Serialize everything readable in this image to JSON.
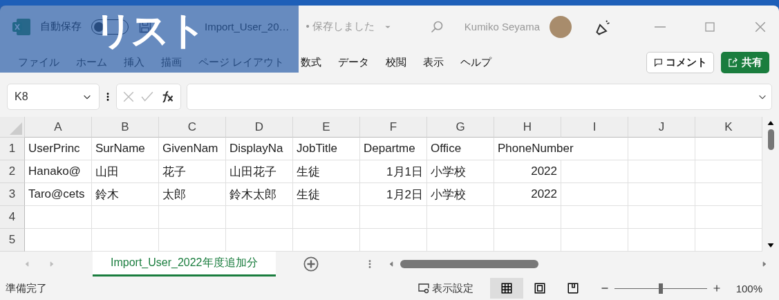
{
  "title_bar": {
    "autosave_label": "自動保存",
    "autosave_toggle": {
      "on": false
    },
    "file_name": "Import_User_20…",
    "save_status": "• 保存しました",
    "user_name": "Kumiko Seyama"
  },
  "overlay_label": "リスト",
  "ribbon_tabs": [
    "ファイル",
    "ホーム",
    "挿入",
    "描画",
    "ページ レイアウト",
    "数式",
    "データ",
    "校閲",
    "表示",
    "ヘルプ"
  ],
  "ribbon_buttons": {
    "comment": "コメント",
    "share": "共有"
  },
  "name_box": "K8",
  "columns": [
    "A",
    "B",
    "C",
    "D",
    "E",
    "F",
    "G",
    "H",
    "I",
    "J",
    "K"
  ],
  "rows": [
    {
      "number": "1",
      "cells": [
        {
          "text": "UserPrinc",
          "kind": "text"
        },
        {
          "text": "SurName",
          "kind": "text"
        },
        {
          "text": "GivenNam",
          "kind": "text"
        },
        {
          "text": "DisplayNa",
          "kind": "text"
        },
        {
          "text": "JobTitle",
          "kind": "text"
        },
        {
          "text": "Departme",
          "kind": "text"
        },
        {
          "text": "Office",
          "kind": "text"
        },
        {
          "text": "PhoneNumber",
          "kind": "text"
        }
      ]
    },
    {
      "number": "2",
      "cells": [
        {
          "text": "Hanako@",
          "kind": "text"
        },
        {
          "text": "山田",
          "kind": "text"
        },
        {
          "text": "花子",
          "kind": "text"
        },
        {
          "text": "山田花子",
          "kind": "text"
        },
        {
          "text": "生徒",
          "kind": "text"
        },
        {
          "text": "1月1日",
          "kind": "number"
        },
        {
          "text": "小学校",
          "kind": "text"
        },
        {
          "text": "2022",
          "kind": "number"
        }
      ]
    },
    {
      "number": "3",
      "cells": [
        {
          "text": "Taro@cets",
          "kind": "text"
        },
        {
          "text": "鈴木",
          "kind": "text"
        },
        {
          "text": "太郎",
          "kind": "text"
        },
        {
          "text": "鈴木太郎",
          "kind": "text"
        },
        {
          "text": "生徒",
          "kind": "text"
        },
        {
          "text": "1月2日",
          "kind": "number"
        },
        {
          "text": "小学校",
          "kind": "text"
        },
        {
          "text": "2022",
          "kind": "number"
        }
      ]
    },
    {
      "number": "4",
      "cells": []
    },
    {
      "number": "5",
      "cells": []
    }
  ],
  "sheet_tabs": [
    {
      "label": "Import_User_2022年度追加分",
      "selected": true
    }
  ],
  "status_bar": {
    "status": "準備完了",
    "display_settings": "表示設定",
    "views": [
      {
        "kind": "normal",
        "selected": true
      },
      {
        "kind": "page_layout",
        "selected": false
      },
      {
        "kind": "page_break",
        "selected": false
      }
    ],
    "zoom": {
      "level": 0.5,
      "label": "100%"
    }
  }
}
